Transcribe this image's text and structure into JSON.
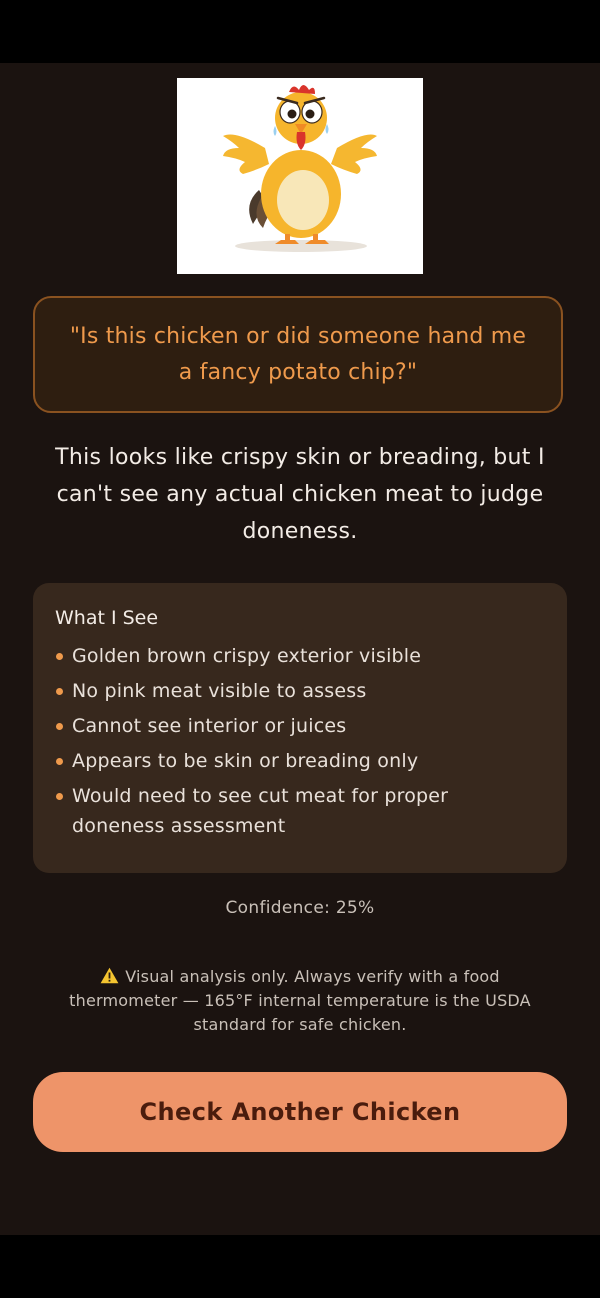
{
  "photo": {
    "subject": "cartoon-chicken",
    "background": "#ffffff"
  },
  "quote": {
    "text": "\"Is this chicken or did someone hand me a fancy potato chip?\""
  },
  "summary": {
    "text": "This looks like crispy skin or breading, but I can't see any actual chicken meat to judge doneness."
  },
  "what_i_see": {
    "title": "What I See",
    "items": [
      "Golden brown crispy exterior visible",
      "No pink meat visible to assess",
      "Cannot see interior or juices",
      "Appears to be skin or breading only",
      "Would need to see cut meat for proper doneness assessment"
    ]
  },
  "confidence": {
    "label": "Confidence: 25%",
    "value": 25
  },
  "disclaimer": {
    "icon": "warning-icon",
    "text": "Visual analysis only. Always verify with a food thermometer — 165°F internal temperature is the USDA standard for safe chicken."
  },
  "cta": {
    "label": "Check Another Chicken"
  },
  "colors": {
    "accent": "#ef9a4c",
    "button": "#ee9469",
    "background": "#1b1310",
    "card": "#37281d"
  }
}
